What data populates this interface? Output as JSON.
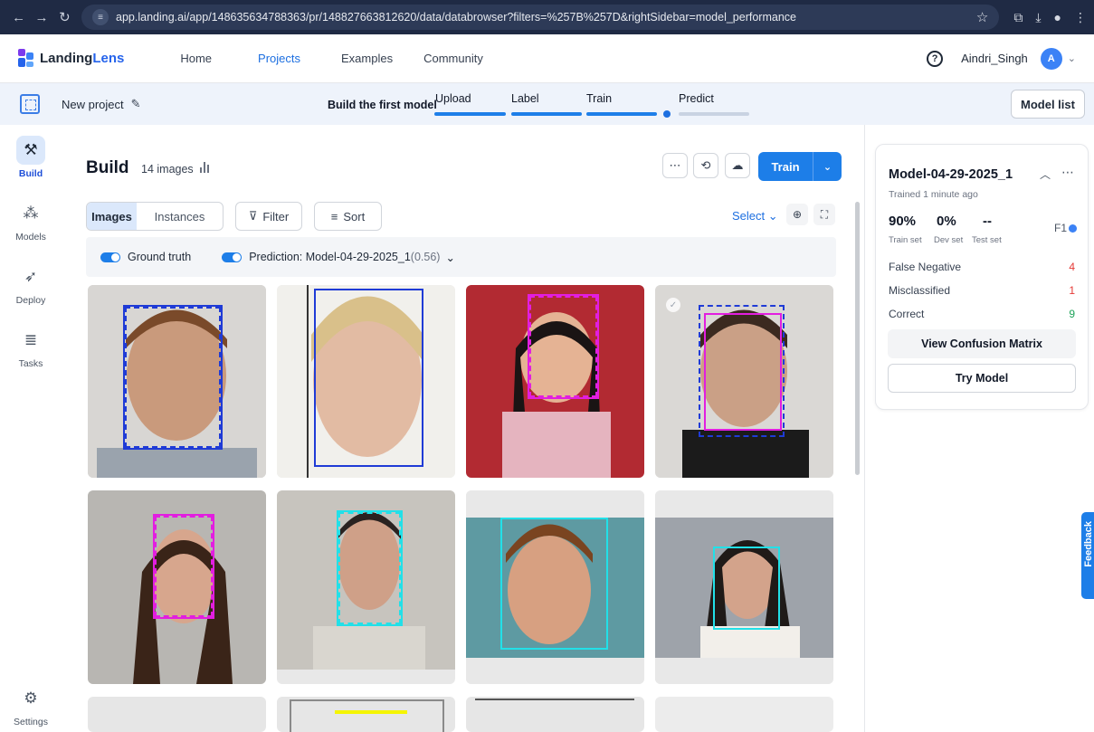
{
  "browser": {
    "url": "app.landing.ai/app/148635634788363/pr/148827663812620/data/databrowser?filters=%257B%257D&rightSidebar=model_performance"
  },
  "nav": {
    "brand_part1": "Landing",
    "brand_part2": "Lens",
    "links": [
      "Home",
      "Projects",
      "Examples",
      "Community"
    ],
    "active_link": "Projects",
    "user_name": "Aindri_Singh",
    "avatar_initial": "A"
  },
  "project_bar": {
    "project_name": "New project",
    "build_first_model": "Build the first model",
    "steps": [
      "Upload",
      "Label",
      "Train",
      "Predict"
    ],
    "model_list": "Model list"
  },
  "sidebar": {
    "items": [
      {
        "label": "Build",
        "icon": "tools-icon"
      },
      {
        "label": "Models",
        "icon": "models-icon"
      },
      {
        "label": "Deploy",
        "icon": "rocket-icon"
      },
      {
        "label": "Tasks",
        "icon": "tasks-icon"
      }
    ],
    "settings": "Settings"
  },
  "build": {
    "title": "Build",
    "image_count": "14 images",
    "train_label": "Train",
    "view_tabs": [
      "Images",
      "Instances"
    ],
    "filter": "Filter",
    "sort": "Sort",
    "select": "Select",
    "ground_truth": "Ground truth",
    "prediction": "Prediction: Model-04-29-2025_1",
    "prediction_score": "(0.56)"
  },
  "model_panel": {
    "name": "Model-04-29-2025_1",
    "trained": "Trained 1 minute ago",
    "metrics": [
      {
        "value": "90%",
        "label": "Train set"
      },
      {
        "value": "0%",
        "label": "Dev set"
      },
      {
        "value": "--",
        "label": "Test set"
      }
    ],
    "f1_label": "F1",
    "stats": [
      {
        "label": "False Negative",
        "value": "4",
        "color": "#e53935"
      },
      {
        "label": "Misclassified",
        "value": "1",
        "color": "#e53935"
      },
      {
        "label": "Correct",
        "value": "9",
        "color": "#1ea35a"
      }
    ],
    "view_confusion": "View Confusion Matrix",
    "try_model": "Try Model"
  },
  "feedback": "Feedback",
  "colors": {
    "accent": "#1d7ee8",
    "ground_truth_box": "#1f3bd6",
    "prediction_box": "#e21ee0",
    "cyan_box": "#22e0e8"
  }
}
